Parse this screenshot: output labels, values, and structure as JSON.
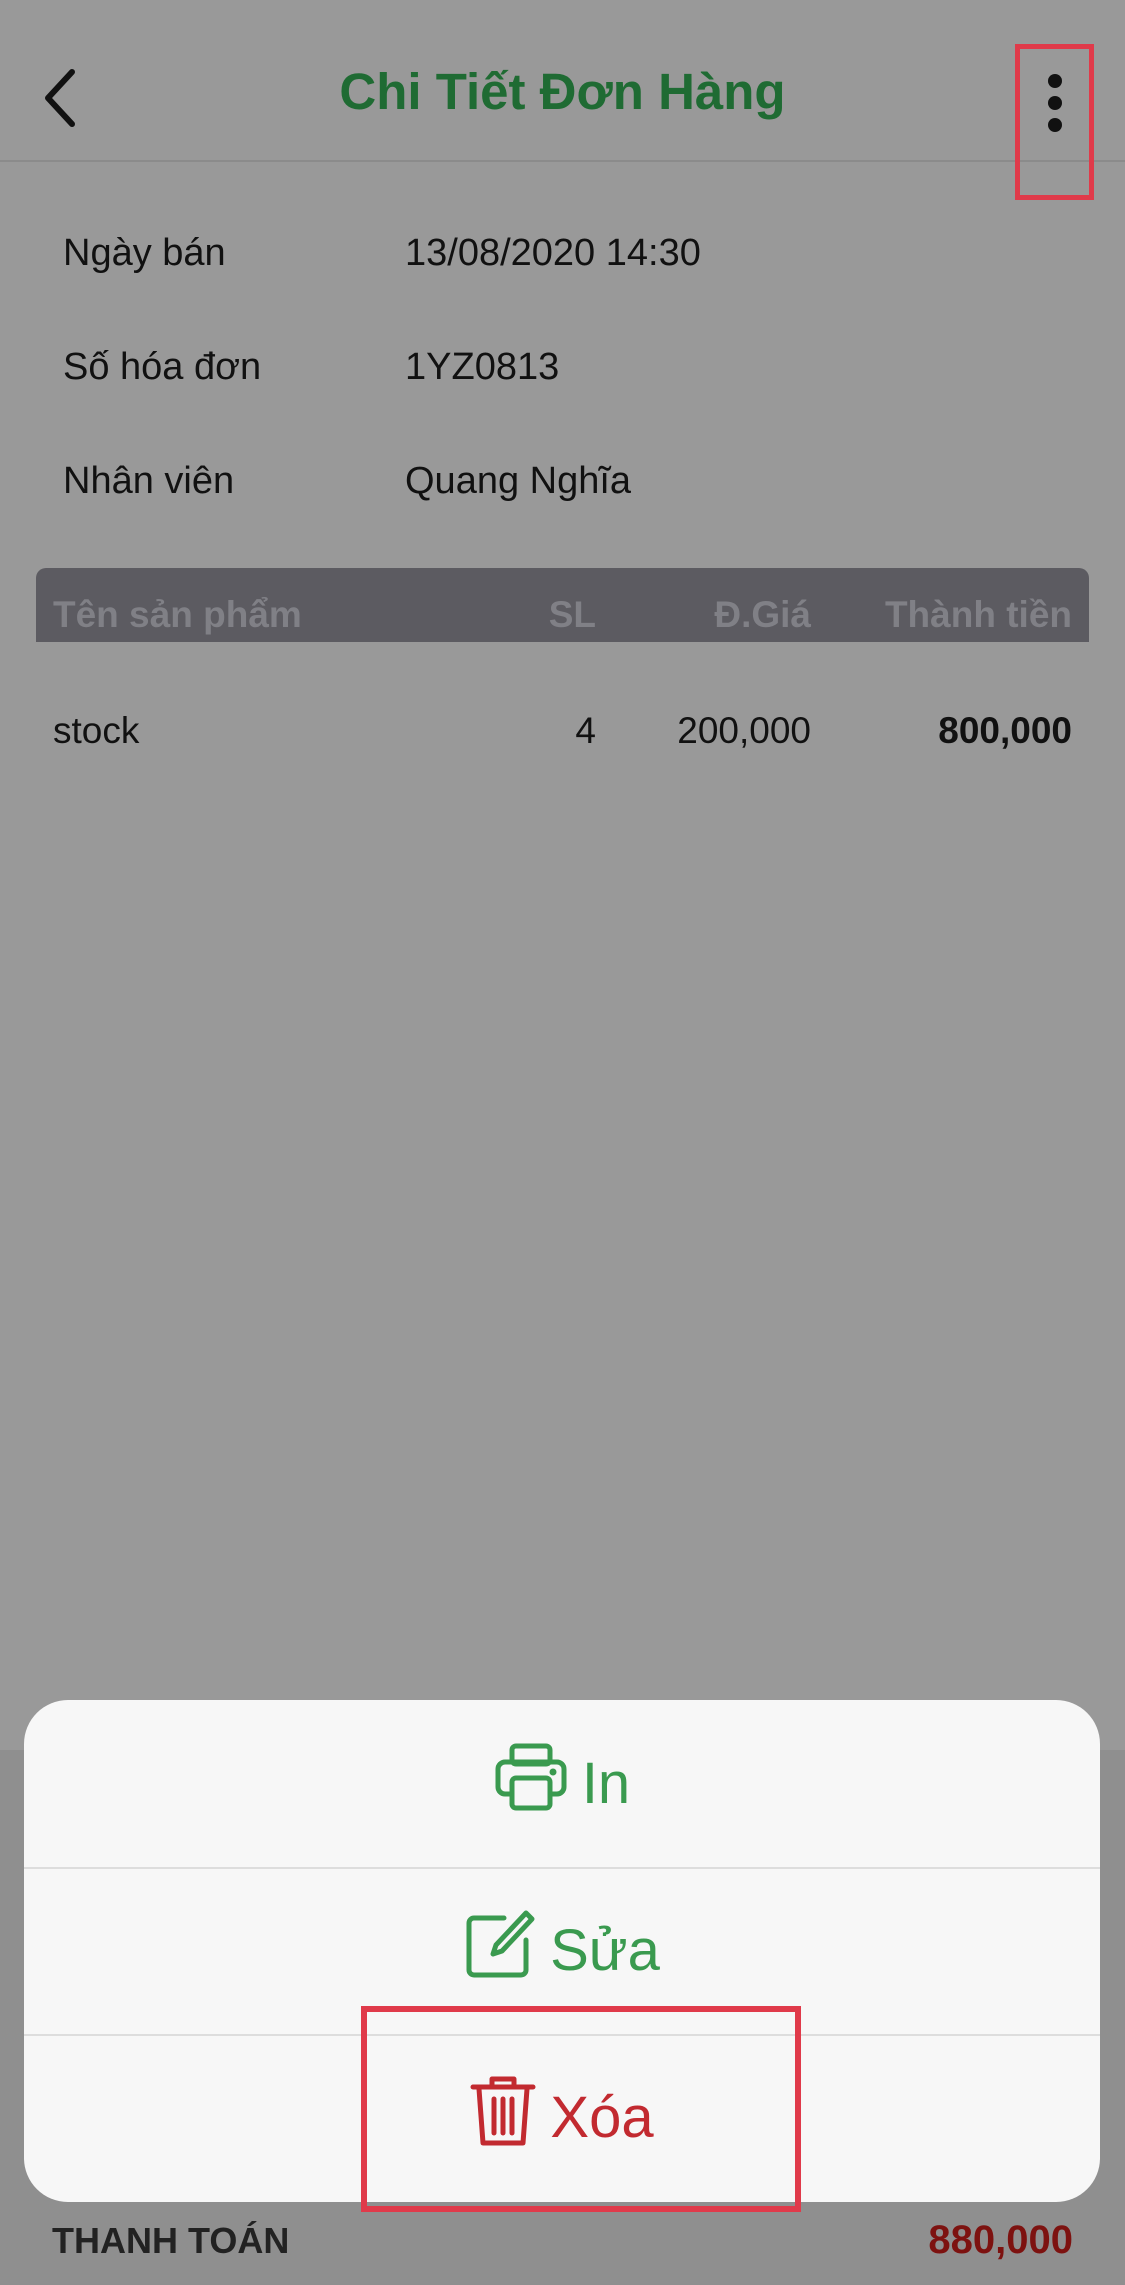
{
  "header": {
    "title": "Chi Tiết Đơn Hàng"
  },
  "icons": {
    "back": "chevron-left-icon",
    "more": "more-vertical-icon",
    "print": "printer-icon",
    "edit": "edit-icon",
    "delete": "trash-icon"
  },
  "info": [
    {
      "label": "Ngày bán",
      "value": "13/08/2020 14:30"
    },
    {
      "label": "Số hóa đơn",
      "value": "1YZ0813"
    },
    {
      "label": "Nhân viên",
      "value": "Quang Nghĩa"
    }
  ],
  "table": {
    "columns": {
      "name": "Tên sản phẩm",
      "qty": "SL",
      "price": "Đ.Giá",
      "total": "Thành tiền"
    },
    "rows": [
      {
        "name": "stock",
        "qty": "4",
        "price": "200,000",
        "total": "800,000"
      }
    ]
  },
  "footer": {
    "pay_label": "THANH TOÁN",
    "pay_value": "880,000"
  },
  "action_sheet": {
    "print": "In",
    "edit": "Sửa",
    "delete": "Xóa"
  },
  "colors": {
    "title_green": "#1f6b33",
    "action_green": "#3a9a4f",
    "delete_red": "#c22a30",
    "highlight_red": "#e03a4a",
    "total_red": "#7d1210"
  }
}
